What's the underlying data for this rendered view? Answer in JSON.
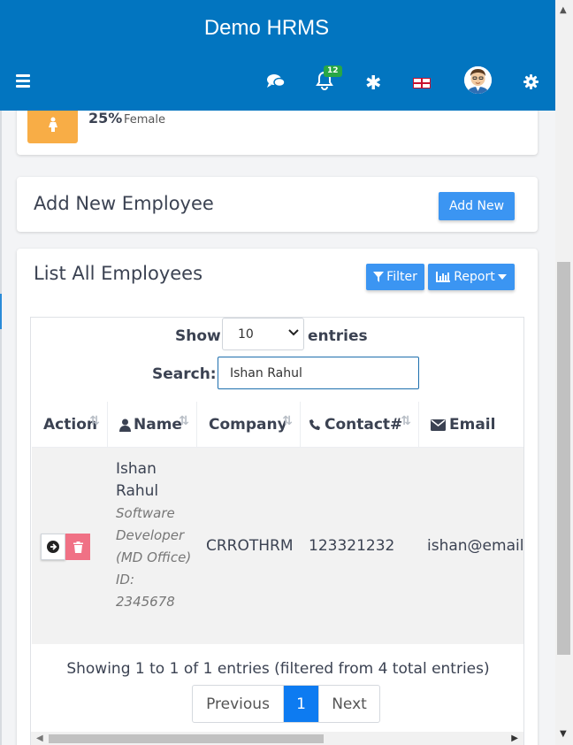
{
  "header": {
    "brand": "Demo HRMS",
    "notifications_count": "12"
  },
  "stat": {
    "percent": "25%",
    "label": "Female"
  },
  "add_employee": {
    "title": "Add New Employee",
    "button": "Add New"
  },
  "list": {
    "title": "List All Employees",
    "filter_button": "Filter",
    "report_button": "Report",
    "show_label": "Show",
    "length_value": "10",
    "entries_label": "entries",
    "search_label": "Search:",
    "search_value": "Ishan Rahul",
    "columns": [
      "Action",
      "Name",
      "Company",
      "Contact#",
      "Email"
    ],
    "rows": [
      {
        "name": "Ishan Rahul",
        "role": "Software Developer (MD Office)",
        "id": "ID: 2345678",
        "company": "CRROTHRM",
        "contact": "123321232",
        "email": "ishan@email.com"
      }
    ],
    "info": "Showing 1 to 1 of 1 entries (filtered from 4 total entries)",
    "pagination": {
      "previous": "Previous",
      "current": "1",
      "next": "Next"
    }
  },
  "colors": {
    "header_bg": "#0275c0",
    "primary_button": "#3b95f2",
    "stat_icon": "#f8ad46",
    "delete_button": "#f07185",
    "active_page": "#0d7bf1"
  }
}
